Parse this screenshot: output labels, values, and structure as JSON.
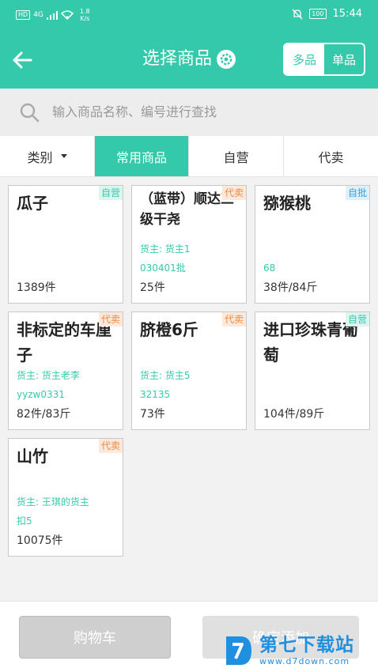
{
  "status": {
    "network": "4G",
    "speed_value": "1.8",
    "speed_unit": "K/s",
    "battery": "100",
    "time": "15:44"
  },
  "header": {
    "title": "选择商品",
    "mode_multi": "多品",
    "mode_single": "单品"
  },
  "search": {
    "placeholder": "输入商品名称、编号进行查找"
  },
  "tabs": [
    {
      "label": "类别"
    },
    {
      "label": "常用商品"
    },
    {
      "label": "自营"
    },
    {
      "label": "代卖"
    }
  ],
  "products": [
    {
      "name": "瓜子",
      "badge": "自营",
      "owner": "",
      "code": "",
      "qty": "1389件"
    },
    {
      "name": "（蓝带）顺达三级干尧",
      "badge": "代卖",
      "owner": "货主: 货主1",
      "code": "030401批",
      "qty": "25件"
    },
    {
      "name": "猕猴桃",
      "badge": "自批",
      "owner": "",
      "code": "68",
      "qty": "38件/84斤"
    },
    {
      "name": "非标定的车厘子",
      "badge": "代卖",
      "owner": "货主: 货主老李",
      "code": "yyzw0331",
      "qty": "82件/83斤"
    },
    {
      "name": "脐橙6斤",
      "badge": "代卖",
      "owner": "货主: 货主5",
      "code": "32135",
      "qty": "73件"
    },
    {
      "name": "进口珍珠青葡萄",
      "badge": "自营",
      "owner": "",
      "code": "",
      "qty": "104件/89斤"
    },
    {
      "name": "山竹",
      "badge": "代卖",
      "owner": "货主: 王琪的货主",
      "code": "扣5",
      "qty": "10075件"
    }
  ],
  "footer": {
    "cart_label": "购物车",
    "confirm_label": "确定添加"
  },
  "watermark": {
    "name": "第七下载站",
    "url": "www.d7down.com"
  },
  "colors": {
    "accent": "#35c9ac",
    "agent": "#f08a3c",
    "batch": "#3aa0e0"
  }
}
